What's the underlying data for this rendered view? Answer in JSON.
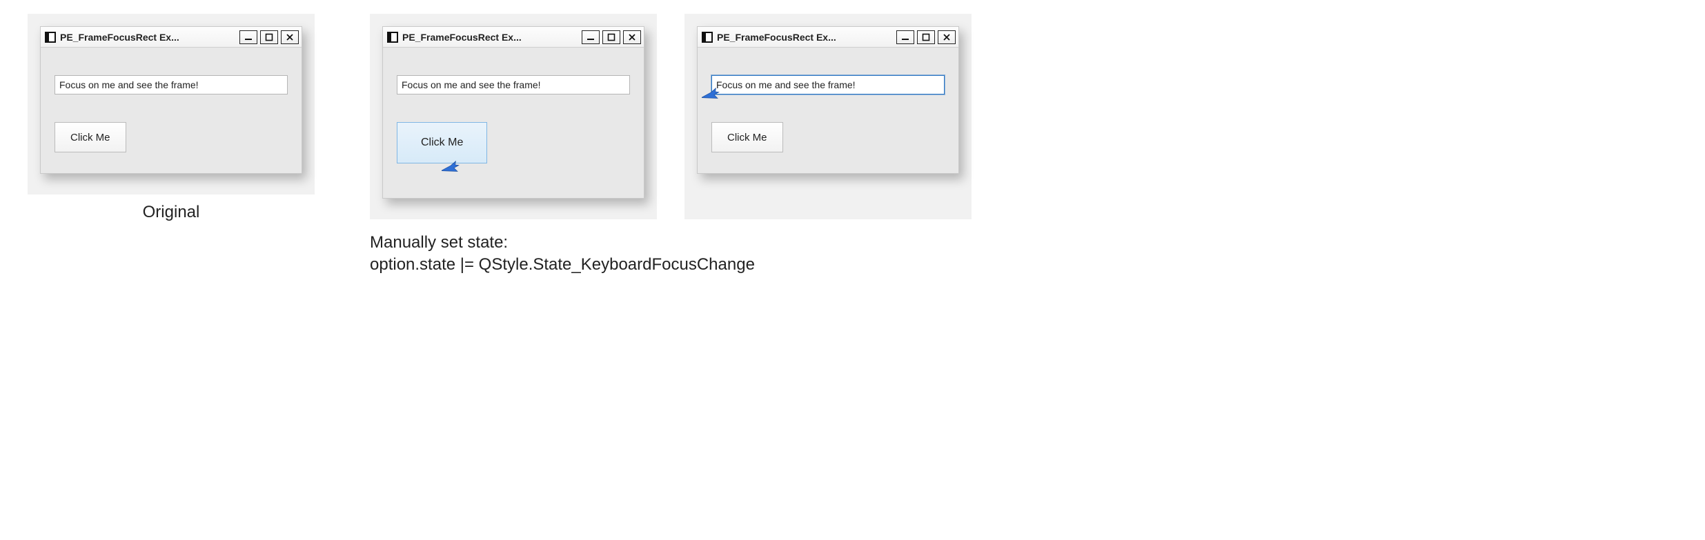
{
  "window_title": "PE_FrameFocusRect Ex...",
  "lineedit_text": "Focus on me and see the frame!",
  "button_label": "Click Me",
  "captions": {
    "left": "Original",
    "right_line1": "Manually set state:",
    "right_line2": "option.state |= QStyle.State_KeyboardFocusChange"
  },
  "icons": {
    "app": "app-icon",
    "minimize": "minimize-icon",
    "maximize": "maximize-icon",
    "close": "close-icon",
    "cursor": "cursor-arrow-icon"
  }
}
